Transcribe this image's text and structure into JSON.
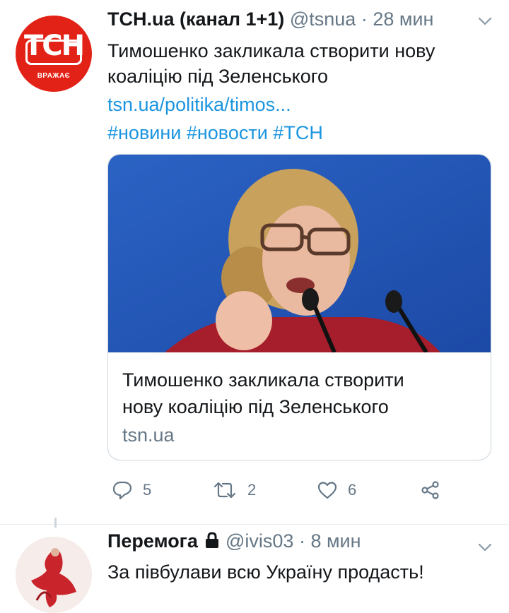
{
  "tweet1": {
    "avatar": {
      "logo_text": "ТСН",
      "logo_sub": "ВРАЖАЄ"
    },
    "name": "ТСН.ua (канал 1+1)",
    "handle": "@tsnua",
    "sep": "·",
    "time": "28 мин",
    "text_line1": "Тимошенко закликала створити нову",
    "text_line2": "коаліцію під Зеленського",
    "link": "tsn.ua/politika/timos...",
    "hashtags": "#новини #новости #ТСН",
    "card": {
      "title_line1": "Тимошенко закликала створити",
      "title_line2": "нову коаліцію під Зеленського",
      "domain": "tsn.ua"
    },
    "actions": {
      "reply_count": "5",
      "retweet_count": "2",
      "like_count": "6"
    }
  },
  "tweet2": {
    "name": "Перемога",
    "handle": "@ivis03",
    "sep": "·",
    "time": "8 мин",
    "text": "За півбулави всю Україну продасть!"
  },
  "colors": {
    "link": "#1b95e0",
    "secondary": "#657786",
    "brand_red": "#e32217"
  },
  "icons": [
    "reply-icon",
    "retweet-icon",
    "like-icon",
    "share-icon",
    "chevron-down-icon",
    "lock-icon"
  ]
}
